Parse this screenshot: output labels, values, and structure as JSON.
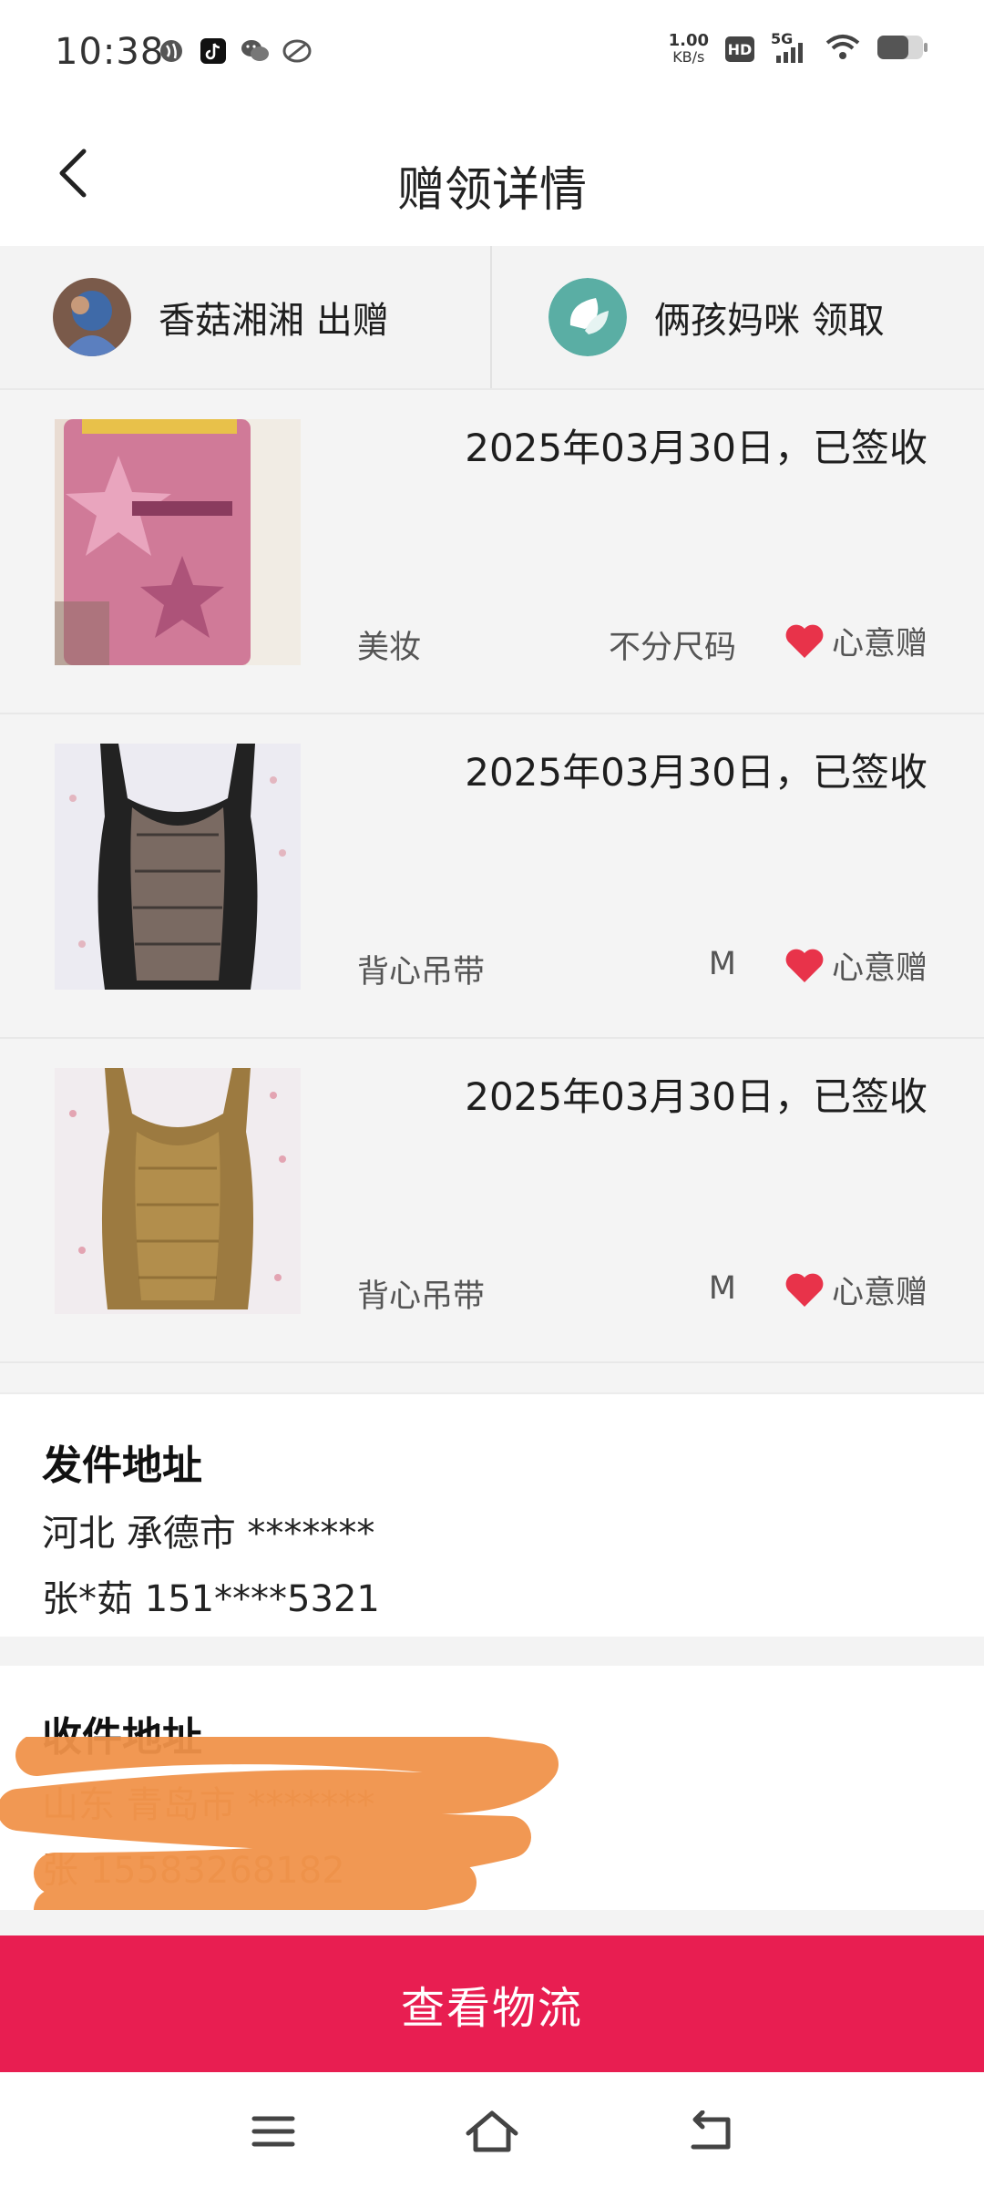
{
  "status_bar": {
    "time": "10:38",
    "net_speed_value": "1.00",
    "net_speed_unit": "KB/s",
    "hd_label": "HD",
    "network": "5G",
    "icons": [
      "browser-icon",
      "tiktok-icon",
      "wechat-icon",
      "app-icon",
      "signal-icon",
      "wifi-icon",
      "battery-icon"
    ]
  },
  "header": {
    "title": "赠领详情",
    "back_icon": "chevron-left-icon"
  },
  "parties": {
    "giver": "香菇湘湘 出赠",
    "receiver": "俩孩妈咪 领取"
  },
  "items": [
    {
      "date_status": "2025年03月30日，已签收",
      "category": "美妆",
      "size": "不分尺码",
      "tag": "心意赠",
      "image": "pink-makeup-bottle"
    },
    {
      "date_status": "2025年03月30日，已签收",
      "category": "背心吊带",
      "size": "M",
      "tag": "心意赠",
      "image": "black-lace-camisole"
    },
    {
      "date_status": "2025年03月30日，已签收",
      "category": "背心吊带",
      "size": "M",
      "tag": "心意赠",
      "image": "tan-lace-camisole"
    }
  ],
  "sender_address": {
    "title": "发件地址",
    "region": "河北 承德市 *******",
    "contact": "张*茹 151****5321"
  },
  "receiver_address": {
    "title": "收件地址",
    "region": "山东 青岛市 *******",
    "contact": "张 15583268182"
  },
  "action": {
    "logistics_label": "查看物流"
  },
  "colors": {
    "accent": "#e81e51",
    "heart": "#e8334a",
    "redaction": "#f0924a"
  }
}
